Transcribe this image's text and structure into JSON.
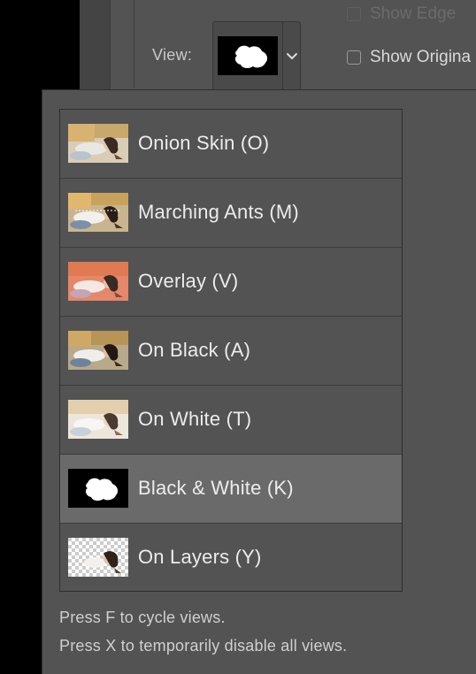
{
  "header": {
    "view_label": "View:",
    "show_edge_label": "Show Edge",
    "show_original_label": "Show Origina"
  },
  "colors": {
    "panel": "#535353",
    "selected_row": "#6a6a6a",
    "text": "#ececec"
  },
  "view_menu": {
    "selected_index": 5,
    "items": [
      {
        "label": "Onion Skin (O)",
        "thumb": "onion-skin-thumbnail"
      },
      {
        "label": "Marching Ants (M)",
        "thumb": "marching-ants-thumbnail"
      },
      {
        "label": "Overlay (V)",
        "thumb": "overlay-thumbnail"
      },
      {
        "label": "On Black (A)",
        "thumb": "on-black-thumbnail"
      },
      {
        "label": "On White (T)",
        "thumb": "on-white-thumbnail"
      },
      {
        "label": "Black & White (K)",
        "thumb": "black-white-mask-thumbnail"
      },
      {
        "label": "On Layers (Y)",
        "thumb": "on-layers-thumbnail"
      }
    ]
  },
  "hints": {
    "cycle": "Press F to cycle views.",
    "disable": "Press X to temporarily disable all views."
  }
}
